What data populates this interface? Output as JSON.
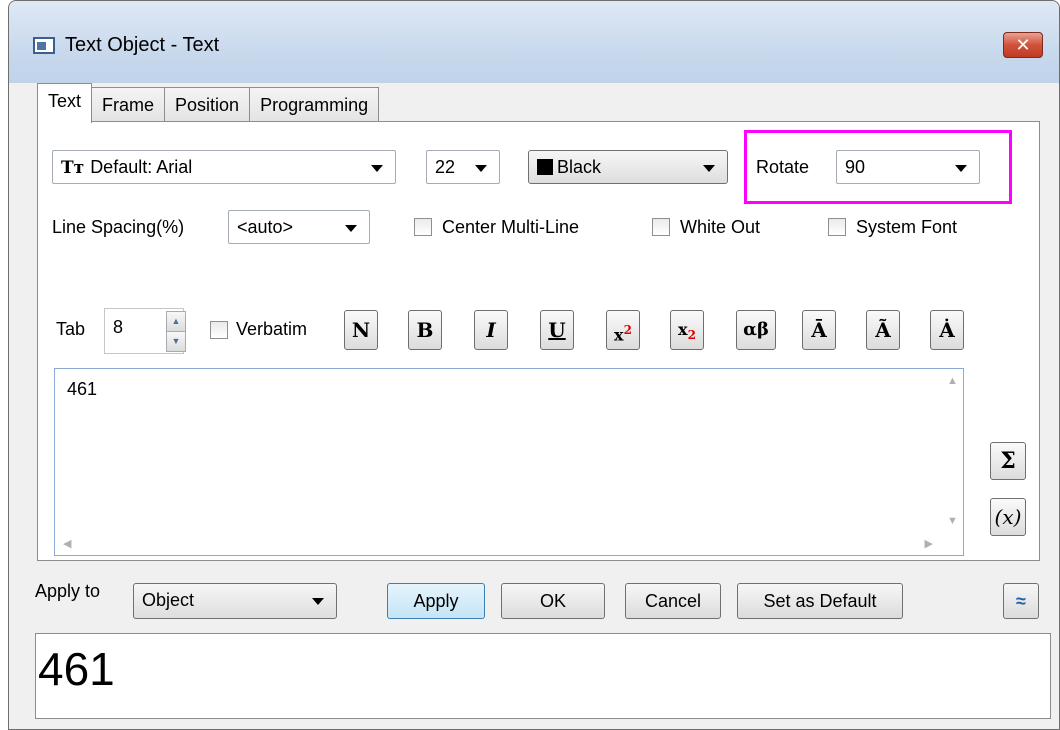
{
  "window": {
    "title": "Text Object - Text",
    "close_label": "✕"
  },
  "tabs": [
    {
      "label": "Text"
    },
    {
      "label": "Frame"
    },
    {
      "label": "Position"
    },
    {
      "label": "Programming"
    }
  ],
  "font": {
    "value": "Default: Arial",
    "icon": "truetype-font-icon"
  },
  "size": {
    "value": "22"
  },
  "color": {
    "value": "Black",
    "swatch": "#000000"
  },
  "rotate": {
    "label": "Rotate",
    "value": "90"
  },
  "line_spacing": {
    "label": "Line Spacing(%)",
    "value": "<auto>"
  },
  "options": {
    "center_multiline": "Center Multi-Line",
    "white_out": "White Out",
    "system_font": "System Font",
    "verbatim": "Verbatim"
  },
  "tab": {
    "label": "Tab",
    "value": "8"
  },
  "format_buttons": {
    "normal": "N",
    "bold": "B",
    "italic": "I",
    "underline": "U",
    "superscript_base": "x",
    "superscript_exp": "2",
    "subscript_base": "x",
    "subscript_idx": "2",
    "greek": "αβ",
    "overbar": "Ā",
    "tilde": "Ã",
    "dot": "Ȧ"
  },
  "editor": {
    "text": "461"
  },
  "side_buttons": {
    "sum": "Σ",
    "variable": "(x)"
  },
  "bottom": {
    "apply_to_label": "Apply to",
    "apply_to_value": "Object",
    "apply": "Apply",
    "ok": "OK",
    "cancel": "Cancel",
    "set_default": "Set as Default",
    "collapse": "≈"
  },
  "preview": {
    "text": "461"
  },
  "colors": {
    "highlight": "#ff00ff",
    "accent": "#3c7fb1"
  }
}
